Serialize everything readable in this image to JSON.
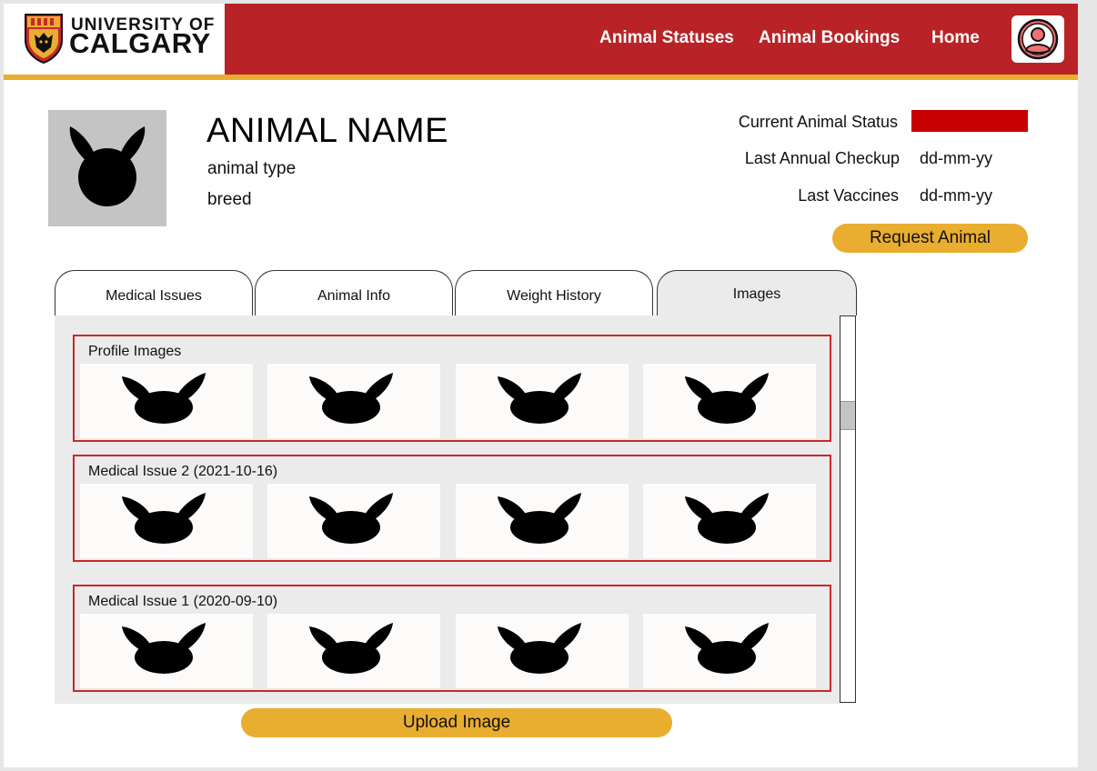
{
  "brand": {
    "line1": "UNIVERSITY OF",
    "line2": "CALGARY",
    "colors": {
      "primary": "#b92327",
      "accent": "#e9ad2f"
    }
  },
  "nav": {
    "items": [
      {
        "label": "Animal Statuses"
      },
      {
        "label": "Animal Bookings"
      },
      {
        "label": "Home"
      }
    ],
    "profile_icon": "user-avatar-icon"
  },
  "animal": {
    "name": "ANIMAL NAME",
    "type": "animal type",
    "breed": "breed",
    "photo_icon": "animal-silhouette-icon"
  },
  "status": {
    "current_label": "Current Animal Status",
    "current_color": "#c80000",
    "checkup_label": "Last Annual Checkup",
    "checkup_value": "dd-mm-yy",
    "vaccines_label": "Last Vaccines",
    "vaccines_value": "dd-mm-yy"
  },
  "actions": {
    "request": "Request Animal",
    "upload": "Upload Image"
  },
  "tabs": [
    {
      "label": "Medical Issues",
      "active": false
    },
    {
      "label": "Animal Info",
      "active": false
    },
    {
      "label": "Weight History",
      "active": false
    },
    {
      "label": "Images",
      "active": true
    }
  ],
  "galleries": [
    {
      "title": "Profile Images",
      "image_count": 4
    },
    {
      "title": "Medical Issue 2 (2021-10-16)",
      "image_count": 4
    },
    {
      "title": "Medical Issue 1 (2020-09-10)",
      "image_count": 4
    }
  ]
}
